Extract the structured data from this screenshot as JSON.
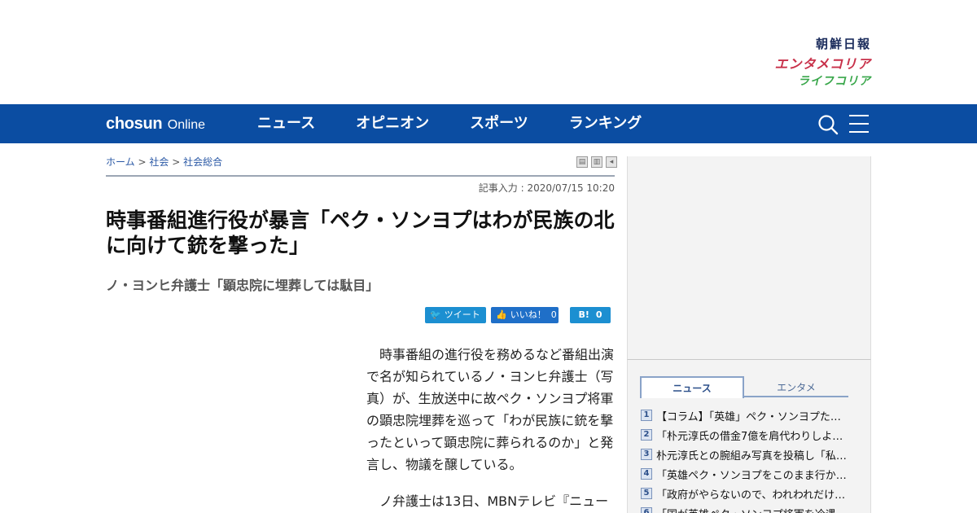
{
  "brands": {
    "chosun": "朝鮮日報",
    "entame": "エンタメコリア",
    "life": "ライフコリア"
  },
  "nav": {
    "logo_main": "chosun",
    "logo_sub": "Online",
    "items": [
      "ニュース",
      "オピニオン",
      "スポーツ",
      "ランキング"
    ],
    "icons": [
      "search-icon",
      "menu-icon"
    ]
  },
  "breadcrumb": {
    "home": "ホーム",
    "sep": ">",
    "level1": "社会",
    "level2": "社会総合"
  },
  "article": {
    "dateline": "記事入力 : 2020/07/15 10:20",
    "headline": "時事番組進行役が暴言「ペク・ソンヨプはわが民族の北に向けて銃を撃った」",
    "subhead": "ノ・ヨンヒ弁護士「顕忠院に埋葬しては駄目」",
    "paragraphs": [
      "時事番組の進行役を務めるなど番組出演で名が知られているノ・ヨンヒ弁護士（写真）が、生放送中に故ペク・ソンヨプ将軍の顕忠院埋葬を巡って「わが民族に銃を撃ったといって顕忠院に葬られるのか」と発言し、物議を醸している。",
      "ノ弁護士は13日、MBNテレビ『ニュー"
    ]
  },
  "social": {
    "tweet_label": "ツイート",
    "like_label": "いいね！",
    "like_count": "0",
    "hatena_label": "B!",
    "hatena_count": "0"
  },
  "sidebar": {
    "tabs": [
      "ニュース",
      "エンタメ"
    ],
    "active_tab": "ニュース",
    "ranking": [
      {
        "num": "1",
        "text": "【コラム】「英雄」ペク・ソンヨプた…"
      },
      {
        "num": "2",
        "text": "「朴元淳氏の借金7億を肩代わりしよ…"
      },
      {
        "num": "3",
        "text": "朴元淳氏との腕組み写真を投稿し「私…"
      },
      {
        "num": "4",
        "text": "「英雄ペク・ソンヨプをこのまま行か…"
      },
      {
        "num": "5",
        "text": "「政府がやらないので、われわれだけ…"
      },
      {
        "num": "6",
        "text": "「国が英雄ペク・ソンヨプ将軍を冷遇"
      }
    ]
  },
  "colors": {
    "nav_bg": "#0b4da2",
    "chosun_brand": "#1b2c5c",
    "entame_brand": "#c8314a",
    "life_brand": "#39a74b"
  }
}
